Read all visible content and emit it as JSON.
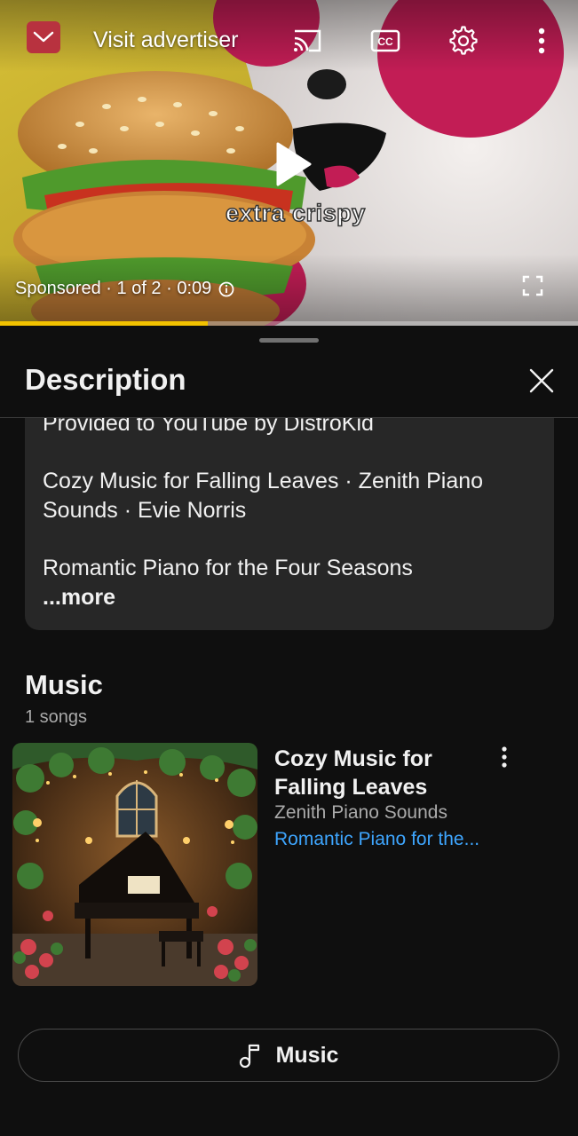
{
  "player": {
    "visit_advertiser_label": "Visit advertiser",
    "ad_overlay_text": "extra crispy",
    "ad_status": "Sponsored · 1 of 2 · 0:09",
    "progress_fraction": 0.36,
    "colors": {
      "progress": "#f2c200",
      "ad_badge": "#b8323f"
    },
    "icons": [
      "minimize-chevron-icon",
      "cast-icon",
      "closed-captions-icon",
      "settings-gear-icon",
      "more-vert-icon",
      "play-icon",
      "info-icon",
      "fullscreen-icon"
    ]
  },
  "sheet": {
    "title": "Description",
    "description": {
      "line1": "Provided to YouTube by DistroKid",
      "line2": "Cozy Music for Falling Leaves · Zenith Piano",
      "line3": "Sounds · Evie Norris",
      "line4": "Romantic Piano for the Four Seasons",
      "more": "...more"
    },
    "music_section": {
      "heading": "Music",
      "count": "1 songs",
      "song": {
        "title_line1": "Cozy Music for",
        "title_line2": "Falling Leaves",
        "artist": "Zenith Piano Sounds",
        "album": "Romantic Piano for the..."
      },
      "button_label": "Music"
    },
    "colors": {
      "background": "#0f0f0f",
      "description_box": "#272727",
      "link": "#3ea6ff",
      "secondary_text": "#aaaaaa"
    }
  }
}
